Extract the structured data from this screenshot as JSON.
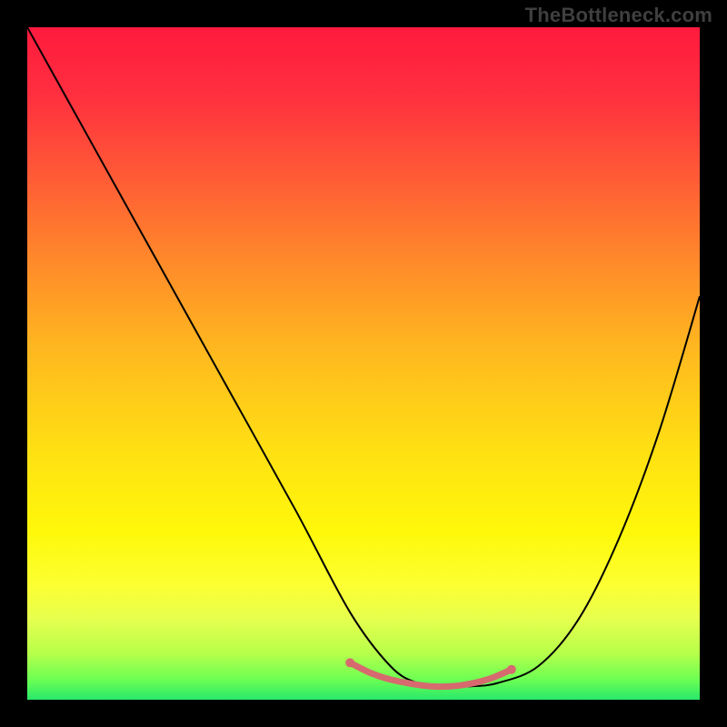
{
  "watermark": "TheBottleneck.com",
  "chart_data": {
    "type": "line",
    "title": "",
    "xlabel": "",
    "ylabel": "",
    "xlim": [
      0,
      100
    ],
    "ylim": [
      0,
      100
    ],
    "series": [
      {
        "name": "curve",
        "x": [
          0,
          10,
          20,
          30,
          40,
          48,
          54,
          58,
          62,
          66,
          70,
          76,
          82,
          88,
          94,
          100
        ],
        "values": [
          100,
          82,
          64,
          46,
          28,
          13,
          5,
          2.5,
          2,
          2,
          2.5,
          5,
          12,
          24,
          40,
          60
        ]
      }
    ],
    "markers": {
      "name": "highlight-band",
      "x": [
        48,
        51,
        54,
        57,
        60,
        63,
        66,
        69,
        72
      ],
      "values": [
        5.5,
        4.0,
        3.0,
        2.4,
        2.0,
        2.0,
        2.4,
        3.2,
        4.5
      ],
      "color": "#d66a6e",
      "radius_px": 5
    },
    "background_gradient": {
      "stops": [
        {
          "pct": 0,
          "color": "#ff1a3e"
        },
        {
          "pct": 50,
          "color": "#ffe013"
        },
        {
          "pct": 100,
          "color": "#28e86a"
        }
      ]
    }
  }
}
